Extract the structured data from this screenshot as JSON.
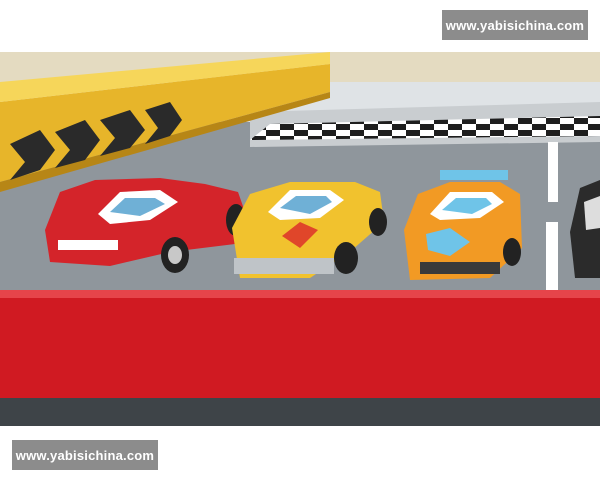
{
  "watermarks": {
    "top_right": "www.yabisichina.com",
    "bottom_left": "www.yabisichina.com"
  },
  "scene": {
    "colors": {
      "sky": "#dfe3e6",
      "barrier": "#f2c53a",
      "chevron": "#2a2a2a",
      "track": "#8f969c",
      "lane_line": "#ffffff",
      "red_band": "#d01a22",
      "dark_band": "#3e4448"
    },
    "cars": [
      {
        "color": "#d4242a",
        "accent": "#ffffff"
      },
      {
        "color": "#f1c22e",
        "accent": "#ffffff"
      },
      {
        "color": "#f29a24",
        "accent": "#6fc4e8"
      },
      {
        "color": "#2b2b2b",
        "accent": "#dddddd"
      }
    ]
  }
}
